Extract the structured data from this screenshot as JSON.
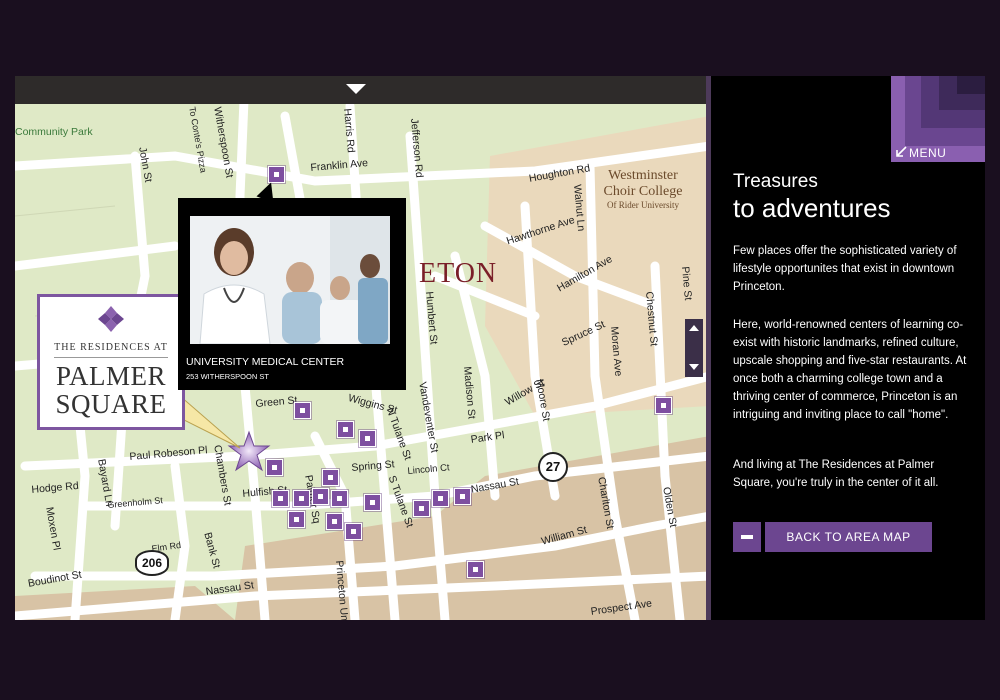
{
  "map": {
    "city_label": "ETON",
    "park_label": "Community Park",
    "college": {
      "line1": "Westminster",
      "line2": "Choir College",
      "line3": "Of Rider University"
    },
    "pizza_label": "To Conte's Pizza",
    "route_shield": "206",
    "route_circle": "27",
    "streets": [
      {
        "name": "Witherspoon St"
      },
      {
        "name": "Harris Rd"
      },
      {
        "name": "Jefferson Rd"
      },
      {
        "name": "Franklin Ave"
      },
      {
        "name": "John St"
      },
      {
        "name": "Houghton Rd"
      },
      {
        "name": "Walnut Ln"
      },
      {
        "name": "Hawthorne Ave"
      },
      {
        "name": "Hamilton Ave"
      },
      {
        "name": "Humbert St"
      },
      {
        "name": "Spruce St"
      },
      {
        "name": "Moran Ave"
      },
      {
        "name": "Chestnut St"
      },
      {
        "name": "Pine St"
      },
      {
        "name": "Madison St"
      },
      {
        "name": "Willow St"
      },
      {
        "name": "Moore St"
      },
      {
        "name": "Vandeventer St"
      },
      {
        "name": "Green St"
      },
      {
        "name": "Wiggins St"
      },
      {
        "name": "N Tulane St"
      },
      {
        "name": "Park Pl"
      },
      {
        "name": "Paul Robeson Pl"
      },
      {
        "name": "Bayard Ln"
      },
      {
        "name": "Hodge Rd"
      },
      {
        "name": "Greenholm St"
      },
      {
        "name": "Chambers St"
      },
      {
        "name": "Hulfish St"
      },
      {
        "name": "Spring St"
      },
      {
        "name": "Palmer Sq"
      },
      {
        "name": "Lincoln Ct"
      },
      {
        "name": "S Tulane St"
      },
      {
        "name": "Nassau St"
      },
      {
        "name": "Charlton St"
      },
      {
        "name": "Olden St"
      },
      {
        "name": "William St"
      },
      {
        "name": "Moxen Pl"
      },
      {
        "name": "Boudinot St"
      },
      {
        "name": "Bank St"
      },
      {
        "name": "Princeton Uni"
      },
      {
        "name": "Prospect Ave"
      },
      {
        "name": "Elm Rd"
      }
    ],
    "popup": {
      "title": "UNIVERSITY MEDICAL CENTER",
      "address": "253 WITHERSPOON ST"
    },
    "logo": {
      "lead": "THE RESIDENCES AT",
      "line1": "PALMER",
      "line2": "SQUARE"
    }
  },
  "panel": {
    "menu_label": "MENU",
    "title_small": "Treasures",
    "title_large": "to adventures",
    "para1": "Few places offer the sophisticated variety of lifestyle opportunites that exist in downtown Princeton.",
    "para2": "Here, world-renowned centers of learning co-exist with historic landmarks, refined culture, upscale shopping and five-star restaurants. At once both a charming college town and a thriving center of commerce, Princeton is an intriguing and inviting place to call \"home\".",
    "para3": "And living at The Residences at Palmer Square, you're truly in the center of it all.",
    "back_label": "BACK TO AREA MAP"
  },
  "colors": {
    "accent": "#6c4690",
    "map_bg": "#dfe9c6",
    "campus": "#d9c9ae",
    "road": "#ffffff"
  }
}
